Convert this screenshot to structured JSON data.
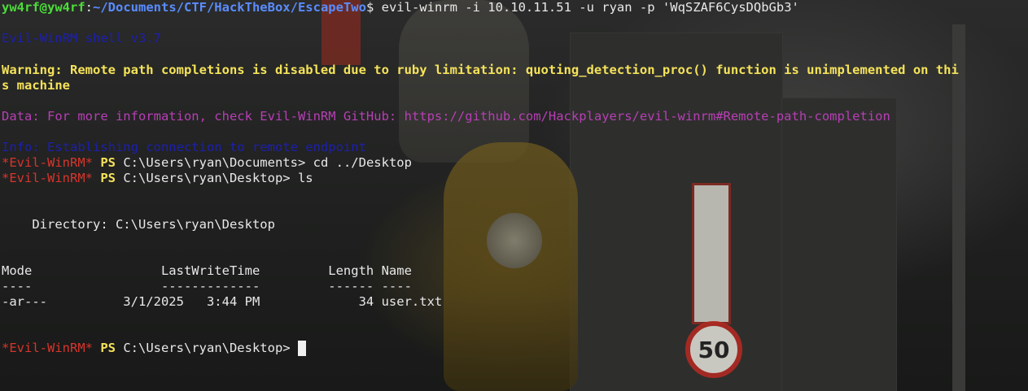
{
  "wallpaper": {
    "speed_limit": "50"
  },
  "prompt": {
    "user_host": "yw4rf@yw4rf",
    "sep": ":",
    "path": "~/Documents/CTF/HackTheBox/EscapeTwo",
    "symbol": "$",
    "command": " evil-winrm -i 10.10.11.51 -u ryan -p 'WqSZAF6CysDQbGb3'"
  },
  "output": {
    "shell_version": "Evil-WinRM shell v3.7",
    "warning_line1": "Warning: Remote path completions is disabled due to ruby limitation: quoting_detection_proc() function is unimplemented on thi",
    "warning_line2": "s machine",
    "data_line": "Data: For more information, check Evil-WinRM GitHub: https://github.com/Hackplayers/evil-winrm#Remote-path-completion",
    "info_line": "Info: Establishing connection to remote endpoint"
  },
  "session": {
    "prompt_tag": "*Evil-WinRM*",
    "ps_label": "PS",
    "cmd1_path": " C:\\Users\\ryan\\Documents>",
    "cmd1": " cd ../Desktop",
    "cmd2_path": " C:\\Users\\ryan\\Desktop>",
    "cmd2": " ls",
    "directory_line": "    Directory: C:\\Users\\ryan\\Desktop",
    "table_header": "Mode                 LastWriteTime         Length Name",
    "table_rule": "----                 -------------         ------ ----",
    "table_rows": [
      "-ar---          3/1/2025   3:44 PM             34 user.txt"
    ],
    "cmd3_path": " C:\\Users\\ryan\\Desktop>",
    "cmd3": " "
  },
  "colors": {
    "prompt_user": "#4cdc3a",
    "prompt_path": "#5a8cff",
    "warning": "#f5e25a",
    "data": "#b73fb5",
    "evil_winrm_tag": "#d8352b"
  }
}
